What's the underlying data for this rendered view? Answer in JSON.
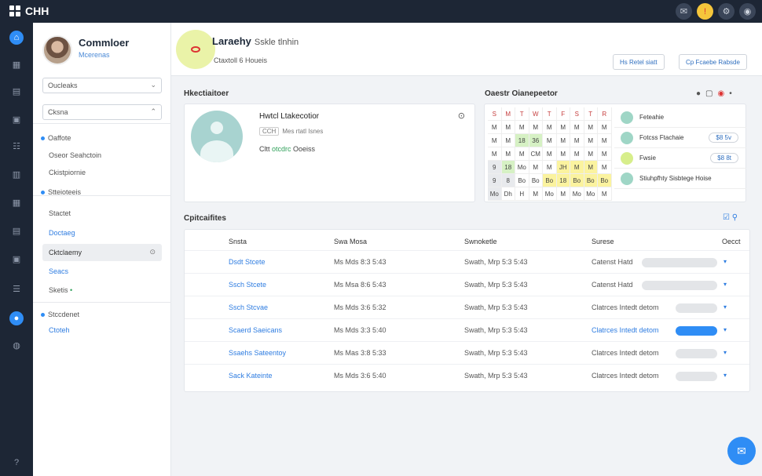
{
  "app": {
    "title": "CHH"
  },
  "side": {
    "user_name": "Commloer",
    "user_role": "Mcerenas",
    "select1": "Oucleaks",
    "select2": "Cksna",
    "section1": "Oaffote",
    "items_a": [
      "Oseor Seahctoin",
      "Ckistpiornie"
    ],
    "section2": "Stteioteeis",
    "items_b": [
      "Stactet",
      "Doctaeg",
      "Cktclaemy",
      "Seacs",
      "Sketis"
    ],
    "section3": "Stccdenet",
    "items_c": [
      "Ctoteh"
    ]
  },
  "header": {
    "title": "Laraehy",
    "title_sub": "Sskle tlnhin",
    "subtitle": "Ctaxtoll 6 Houeis",
    "btn1": "Hs Retel siatt",
    "btn2": "Cp Fcaebe Rabsde"
  },
  "detail": {
    "section_title": "Hkectiaitoer",
    "name": "Hwtcl Ltakecotior",
    "meta": [
      "CCH",
      "Mes rtatl Isnes"
    ],
    "status_prefix": "Cltt",
    "status_ok": "otcdrc",
    "status_rest": "Ooeiss"
  },
  "calendar": {
    "section_title": "Oaestr Oianepeetor",
    "headers": [
      "S",
      "M",
      "T",
      "W",
      "T",
      "F",
      "S",
      "T",
      "R"
    ],
    "rows": [
      [
        "M",
        "M",
        "M",
        "M",
        "M",
        "M",
        "M",
        "M",
        "M"
      ],
      [
        "M",
        "M",
        "18",
        "36",
        "M",
        "M",
        "M",
        "M",
        "M"
      ],
      [
        "M",
        "M",
        "M",
        "CM",
        "M",
        "M",
        "M",
        "M",
        "M"
      ],
      [
        "9",
        "18",
        "Mo",
        "M",
        "M",
        "JH",
        "M",
        "M",
        "M"
      ],
      [
        "9",
        "8",
        "Bo",
        "Bo",
        "Bo",
        "18",
        "Bo",
        "Bo",
        "Bo"
      ],
      [
        "Mo",
        "Dh",
        "H",
        "M",
        "Mo",
        "M",
        "Mo",
        "Mo",
        "M"
      ]
    ]
  },
  "status_list": [
    {
      "label": "Feteahie",
      "pill": ""
    },
    {
      "label": "Fotcss Ftachaie",
      "pill": "$8 5v"
    },
    {
      "label": "Fwsie",
      "pill": "$8 8t"
    },
    {
      "label": "Stiuhpfhty Sisbtege Hoise",
      "pill": ""
    }
  ],
  "table": {
    "section_title": "Cpitcaifites",
    "headers": [
      "Snsta",
      "Swa Mosa",
      "Swnoketle",
      "Surese",
      "Oecct"
    ],
    "rows": [
      {
        "name": "Dsdt Stcete",
        "date": "Ms Mds 8:3 5:43",
        "detail": "Swath, Mrp 5:3 5:43",
        "status": "Catenst Hatd",
        "bar": 0.62,
        "highlight": false
      },
      {
        "name": "Ssch Stcete",
        "date": "Ms Msa 8:6 5:43",
        "detail": "Swath, Mrp 5:3 5:43",
        "status": "Catenst Hatd",
        "bar": 0.62,
        "highlight": false
      },
      {
        "name": "Ssch Stcvae",
        "date": "Ms Mds 3:6 5:32",
        "detail": "Swath, Mrp 5:3 5:43",
        "status": "Clatrces Intedt detom",
        "bar": 0.34,
        "highlight": false
      },
      {
        "name": "Scaerd Saeicans",
        "date": "Ms Mds 3:3 5:40",
        "detail": "Swath, Mrp 5:3 5:43",
        "status": "Clatrces Intedt detom",
        "bar": 0.34,
        "highlight": true
      },
      {
        "name": "Ssaehs Sateentoy",
        "date": "Ms Mas 3:8 5:33",
        "detail": "Swath, Mrp 5:3 5:43",
        "status": "Clatrces Intedt detom",
        "bar": 0.34,
        "highlight": false
      },
      {
        "name": "Sack Kateinte",
        "date": "Ms Mds 3:6 5:40",
        "detail": "Swath, Mrp 5:3 5:43",
        "status": "Clatrces Intedt detom",
        "bar": 0.34,
        "highlight": false
      }
    ]
  },
  "colors": {
    "accent": "#2f8df5",
    "topbar": "#1d2635",
    "link": "#2f7de1"
  }
}
